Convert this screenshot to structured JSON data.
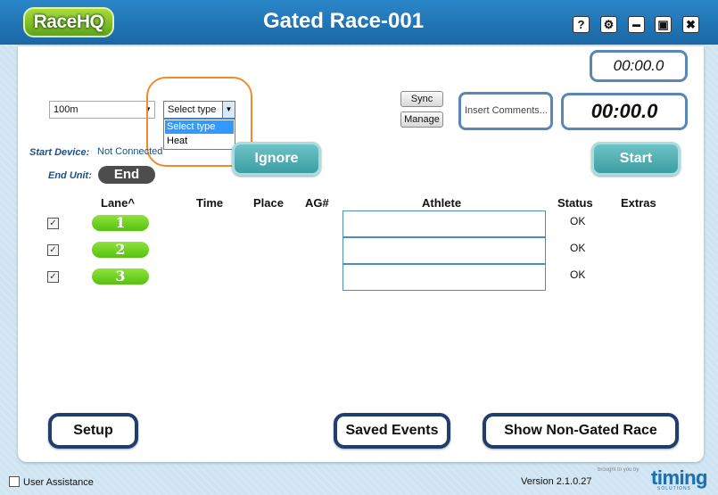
{
  "app": {
    "logo_text": "RaceHQ",
    "title": "Gated Race-001"
  },
  "window_controls": {
    "help": "?",
    "settings": "⚙",
    "minimize": "▬",
    "maximize": "▣",
    "close": "✖"
  },
  "controls": {
    "distance_value": "100m",
    "type_value": "Select type",
    "type_options": [
      "Select type",
      "Heat"
    ],
    "sync_label": "Sync",
    "manage_label": "Manage",
    "comments_placeholder": "Insert Comments...",
    "timer_small": "00:00.0",
    "timer_large": "00:00.0",
    "ignore_label": "Ignore",
    "start_label": "Start"
  },
  "device": {
    "start_device_label": "Start Device:",
    "start_device_status": "Not Connected",
    "end_unit_label": "End Unit:",
    "end_button_label": "End"
  },
  "table": {
    "columns": [
      "Lane^",
      "Time",
      "Place",
      "AG#",
      "Athlete",
      "Status",
      "Extras"
    ],
    "rows": [
      {
        "checked": "✓",
        "lane": "1",
        "status": "OK"
      },
      {
        "checked": "✓",
        "lane": "2",
        "status": "OK"
      },
      {
        "checked": "✓",
        "lane": "3",
        "status": "OK"
      }
    ]
  },
  "bottom_buttons": {
    "setup": "Setup",
    "saved_events": "Saved Events",
    "show_non_gated": "Show Non-Gated Race"
  },
  "footer": {
    "user_assistance": "User Assistance",
    "version": "Version 2.1.0.27",
    "brought_by": "brought to you by",
    "brand": "timing",
    "brand_sub": "SOLUTIONS"
  },
  "colors": {
    "titlebar": "#1e6fae",
    "accent_teal": "#3c9ea3",
    "lane_green": "#56c110",
    "highlight_orange": "#f28a2a",
    "navy_border": "#1e3f6e"
  }
}
